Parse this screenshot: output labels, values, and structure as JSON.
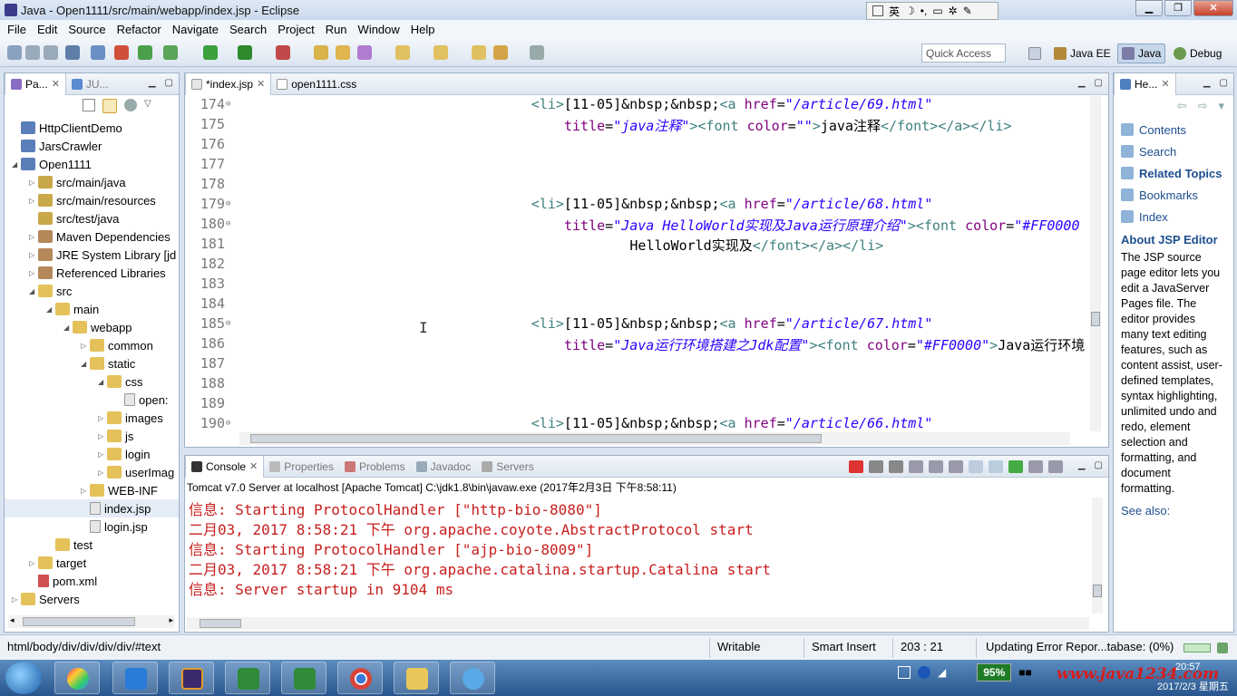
{
  "window": {
    "title": "Java - Open1111/src/main/webapp/index.jsp - Eclipse",
    "ime_label": "英"
  },
  "menu": [
    "File",
    "Edit",
    "Source",
    "Refactor",
    "Navigate",
    "Search",
    "Project",
    "Run",
    "Window",
    "Help"
  ],
  "toolbar": {
    "quick_access_placeholder": "Quick Access",
    "perspectives": [
      "Java EE",
      "Java",
      "Debug"
    ]
  },
  "package_explorer": {
    "tabs": [
      "Pa...",
      "JU..."
    ],
    "tree": [
      {
        "label": "HttpClientDemo",
        "depth": 1,
        "icon": "project",
        "arrow": ""
      },
      {
        "label": "JarsCrawler",
        "depth": 1,
        "icon": "project",
        "arrow": ""
      },
      {
        "label": "Open1111",
        "depth": 1,
        "icon": "project",
        "arrow": "down"
      },
      {
        "label": "src/main/java",
        "depth": 2,
        "icon": "pkgfolder",
        "arrow": "right"
      },
      {
        "label": "src/main/resources",
        "depth": 2,
        "icon": "pkgfolder",
        "arrow": "right"
      },
      {
        "label": "src/test/java",
        "depth": 2,
        "icon": "pkgfolder",
        "arrow": ""
      },
      {
        "label": "Maven Dependencies",
        "depth": 2,
        "icon": "lib",
        "arrow": "right"
      },
      {
        "label": "JRE System Library [jd",
        "depth": 2,
        "icon": "lib",
        "arrow": "right"
      },
      {
        "label": "Referenced Libraries",
        "depth": 2,
        "icon": "lib",
        "arrow": "right"
      },
      {
        "label": "src",
        "depth": 2,
        "icon": "folder",
        "arrow": "down"
      },
      {
        "label": "main",
        "depth": 3,
        "icon": "folder",
        "arrow": "down"
      },
      {
        "label": "webapp",
        "depth": 4,
        "icon": "folder",
        "arrow": "down"
      },
      {
        "label": "common",
        "depth": 5,
        "icon": "folder",
        "arrow": "right"
      },
      {
        "label": "static",
        "depth": 5,
        "icon": "folder",
        "arrow": "down"
      },
      {
        "label": "css",
        "depth": 6,
        "icon": "folder",
        "arrow": "down"
      },
      {
        "label": "open:",
        "depth": 7,
        "icon": "file",
        "arrow": ""
      },
      {
        "label": "images",
        "depth": 6,
        "icon": "folder",
        "arrow": "right"
      },
      {
        "label": "js",
        "depth": 6,
        "icon": "folder",
        "arrow": "right"
      },
      {
        "label": "login",
        "depth": 6,
        "icon": "folder",
        "arrow": "right"
      },
      {
        "label": "userImag",
        "depth": 6,
        "icon": "folder",
        "arrow": "right"
      },
      {
        "label": "WEB-INF",
        "depth": 5,
        "icon": "folder",
        "arrow": "right"
      },
      {
        "label": "index.jsp",
        "depth": 5,
        "icon": "file",
        "arrow": "",
        "selected": true
      },
      {
        "label": "login.jsp",
        "depth": 5,
        "icon": "file",
        "arrow": ""
      },
      {
        "label": "test",
        "depth": 3,
        "icon": "folder",
        "arrow": ""
      },
      {
        "label": "target",
        "depth": 2,
        "icon": "folder",
        "arrow": "right"
      },
      {
        "label": "pom.xml",
        "depth": 2,
        "icon": "xml",
        "arrow": ""
      },
      {
        "label": "Servers",
        "depth": 1,
        "icon": "folder",
        "arrow": "right"
      }
    ]
  },
  "editor": {
    "tabs": [
      "*index.jsp",
      "open1111.css"
    ],
    "lines": [
      {
        "no": "174",
        "fold": true,
        "indent": 36,
        "parts": [
          [
            "tag",
            "<li>"
          ],
          [
            "plain",
            "[11-05]&nbsp;&nbsp;"
          ],
          [
            "tag",
            "<a "
          ],
          [
            "attr",
            "href"
          ],
          [
            "plain",
            "="
          ],
          [
            "str",
            "\"/article/69.html\""
          ]
        ]
      },
      {
        "no": "175",
        "fold": false,
        "indent": 40,
        "parts": [
          [
            "attr",
            "title"
          ],
          [
            "plain",
            "="
          ],
          [
            "str",
            "\"java注释\""
          ],
          [
            "tag",
            ">"
          ],
          [
            "tag",
            "<font "
          ],
          [
            "attr",
            "color"
          ],
          [
            "plain",
            "="
          ],
          [
            "str",
            "\"\""
          ],
          [
            "tag",
            ">"
          ],
          [
            "plain",
            "java注释"
          ],
          [
            "tag",
            "</font></a></li>"
          ]
        ]
      },
      {
        "no": "176",
        "fold": false,
        "indent": 0,
        "parts": []
      },
      {
        "no": "177",
        "fold": false,
        "indent": 0,
        "parts": []
      },
      {
        "no": "178",
        "fold": false,
        "indent": 0,
        "parts": []
      },
      {
        "no": "179",
        "fold": true,
        "indent": 36,
        "parts": [
          [
            "tag",
            "<li>"
          ],
          [
            "plain",
            "[11-05]&nbsp;&nbsp;"
          ],
          [
            "tag",
            "<a "
          ],
          [
            "attr",
            "href"
          ],
          [
            "plain",
            "="
          ],
          [
            "str",
            "\"/article/68.html\""
          ]
        ]
      },
      {
        "no": "180",
        "fold": true,
        "indent": 40,
        "parts": [
          [
            "attr",
            "title"
          ],
          [
            "plain",
            "="
          ],
          [
            "str",
            "\"Java HelloWorld实现及Java运行原理介绍\""
          ],
          [
            "tag",
            ">"
          ],
          [
            "tag",
            "<font "
          ],
          [
            "attr",
            "color"
          ],
          [
            "plain",
            "="
          ],
          [
            "str",
            "\"#FF0000"
          ]
        ]
      },
      {
        "no": "181",
        "fold": false,
        "indent": 48,
        "parts": [
          [
            "plain",
            "HelloWorld实现及"
          ],
          [
            "tag",
            "</font></a></li>"
          ]
        ]
      },
      {
        "no": "182",
        "fold": false,
        "indent": 0,
        "parts": []
      },
      {
        "no": "183",
        "fold": false,
        "indent": 0,
        "parts": []
      },
      {
        "no": "184",
        "fold": false,
        "indent": 0,
        "parts": []
      },
      {
        "no": "185",
        "fold": true,
        "indent": 36,
        "parts": [
          [
            "tag",
            "<li>"
          ],
          [
            "plain",
            "[11-05]&nbsp;&nbsp;"
          ],
          [
            "tag",
            "<a "
          ],
          [
            "attr",
            "href"
          ],
          [
            "plain",
            "="
          ],
          [
            "str",
            "\"/article/67.html\""
          ]
        ]
      },
      {
        "no": "186",
        "fold": false,
        "indent": 40,
        "parts": [
          [
            "attr",
            "title"
          ],
          [
            "plain",
            "="
          ],
          [
            "str",
            "\"Java运行环境搭建之Jdk配置\""
          ],
          [
            "tag",
            ">"
          ],
          [
            "tag",
            "<font "
          ],
          [
            "attr",
            "color"
          ],
          [
            "plain",
            "="
          ],
          [
            "str",
            "\"#FF0000\""
          ],
          [
            "tag",
            ">"
          ],
          [
            "plain",
            "Java运行环境"
          ]
        ]
      },
      {
        "no": "187",
        "fold": false,
        "indent": 0,
        "parts": []
      },
      {
        "no": "188",
        "fold": false,
        "indent": 0,
        "parts": []
      },
      {
        "no": "189",
        "fold": false,
        "indent": 0,
        "parts": []
      },
      {
        "no": "190",
        "fold": true,
        "indent": 36,
        "parts": [
          [
            "tag",
            "<li>"
          ],
          [
            "plain",
            "[11-05]&nbsp;&nbsp;"
          ],
          [
            "tag",
            "<a "
          ],
          [
            "attr",
            "href"
          ],
          [
            "plain",
            "="
          ],
          [
            "str",
            "\"/article/66.html\""
          ]
        ]
      }
    ]
  },
  "console": {
    "tabs": [
      "Console",
      "Properties",
      "Problems",
      "Javadoc",
      "Servers"
    ],
    "description": "Tomcat v7.0 Server at localhost [Apache Tomcat] C:\\jdk1.8\\bin\\javaw.exe (2017年2月3日 下午8:58:11)",
    "lines": [
      "信息: Starting ProtocolHandler [\"http-bio-8080\"]",
      "二月03, 2017 8:58:21 下午 org.apache.coyote.AbstractProtocol start",
      "信息: Starting ProtocolHandler [\"ajp-bio-8009\"]",
      "二月03, 2017 8:58:21 下午 org.apache.catalina.startup.Catalina start",
      "信息: Server startup in 9104 ms"
    ]
  },
  "help": {
    "tab": "He...",
    "links": [
      "Contents",
      "Search",
      "Related Topics",
      "Bookmarks",
      "Index"
    ],
    "about_title": "About JSP Editor",
    "about_body": "The JSP source page editor lets you edit a JavaServer Pages file. The editor provides many text editing features, such as content assist, user-defined templates, syntax highlighting, unlimited undo and redo, element selection and formatting, and document formatting.",
    "see_also": "See also:"
  },
  "status": {
    "path": "html/body/div/div/div/div/#text",
    "writable": "Writable",
    "insert_mode": "Smart Insert",
    "position": "203 : 21",
    "progress": "Updating Error Repor...tabase: (0%)"
  },
  "taskbar": {
    "battery": "95%",
    "watermark": "www.java1234.com",
    "time": "20:57",
    "date": "2017/2/3 星期五"
  }
}
